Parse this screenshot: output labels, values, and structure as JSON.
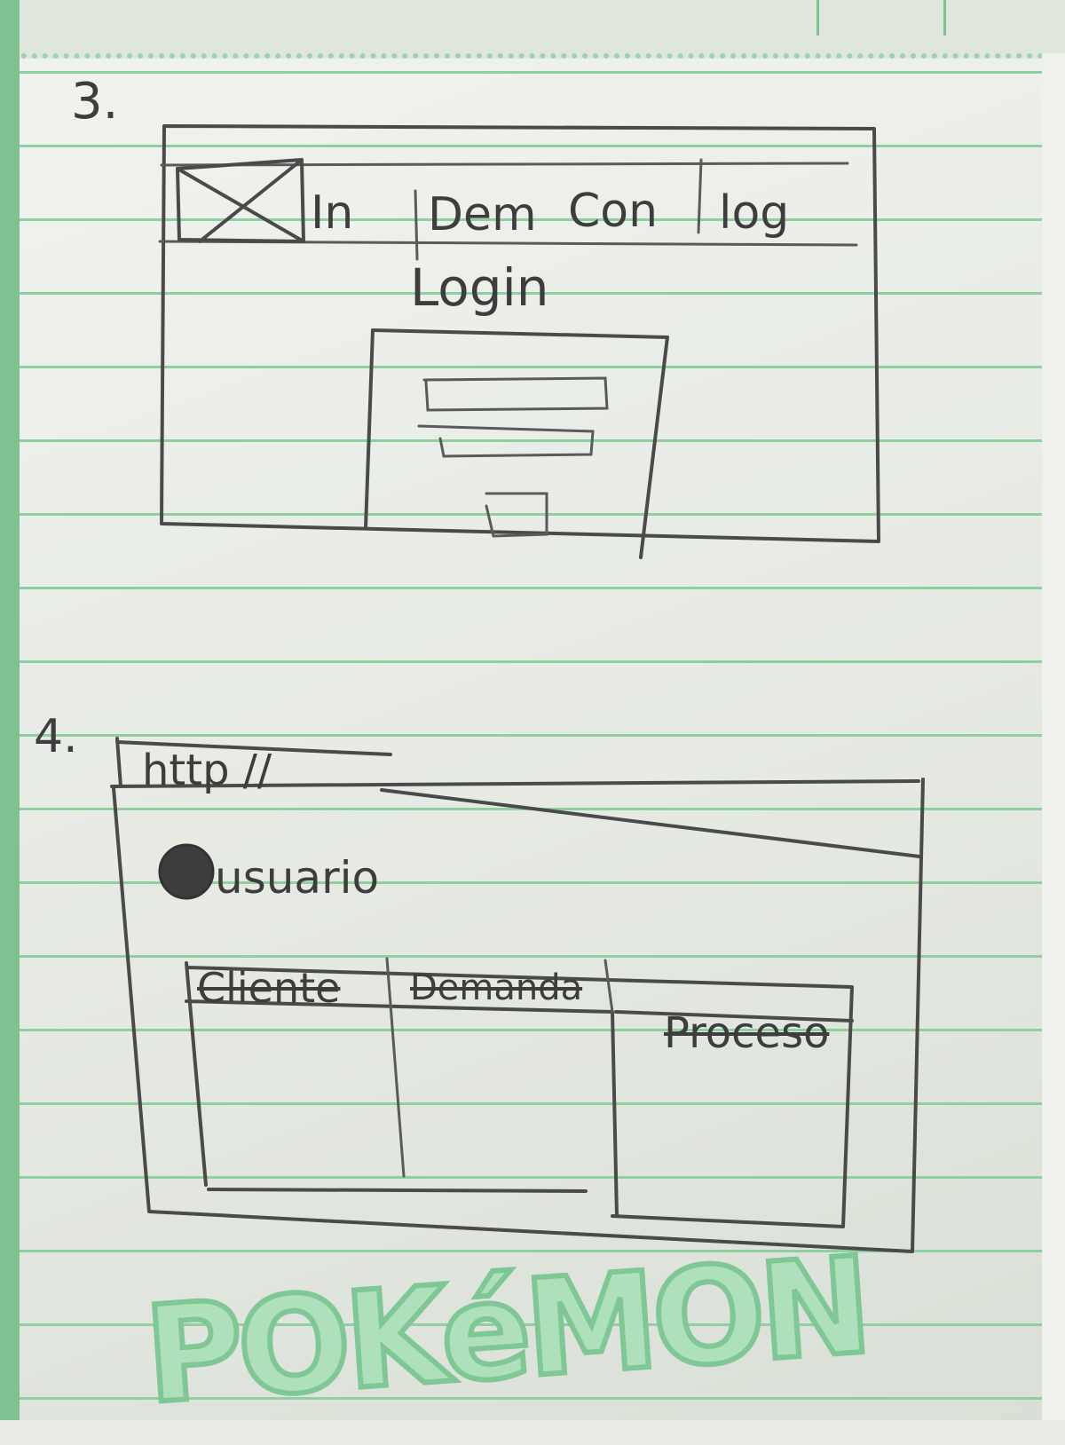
{
  "sketch_3": {
    "number": "3.",
    "nav": [
      "In",
      "Dem",
      "Con",
      "log"
    ],
    "heading": "Login"
  },
  "sketch_4": {
    "number": "4.",
    "url": "http //",
    "user_label": "usuario",
    "columns": [
      "Cliente",
      "Demanda",
      "Proceso"
    ]
  },
  "logo_text": "POKéMON",
  "colors": {
    "paper": "#eef1ec",
    "lines": "#8fcfa0",
    "pencil": "#4a4a4a"
  }
}
